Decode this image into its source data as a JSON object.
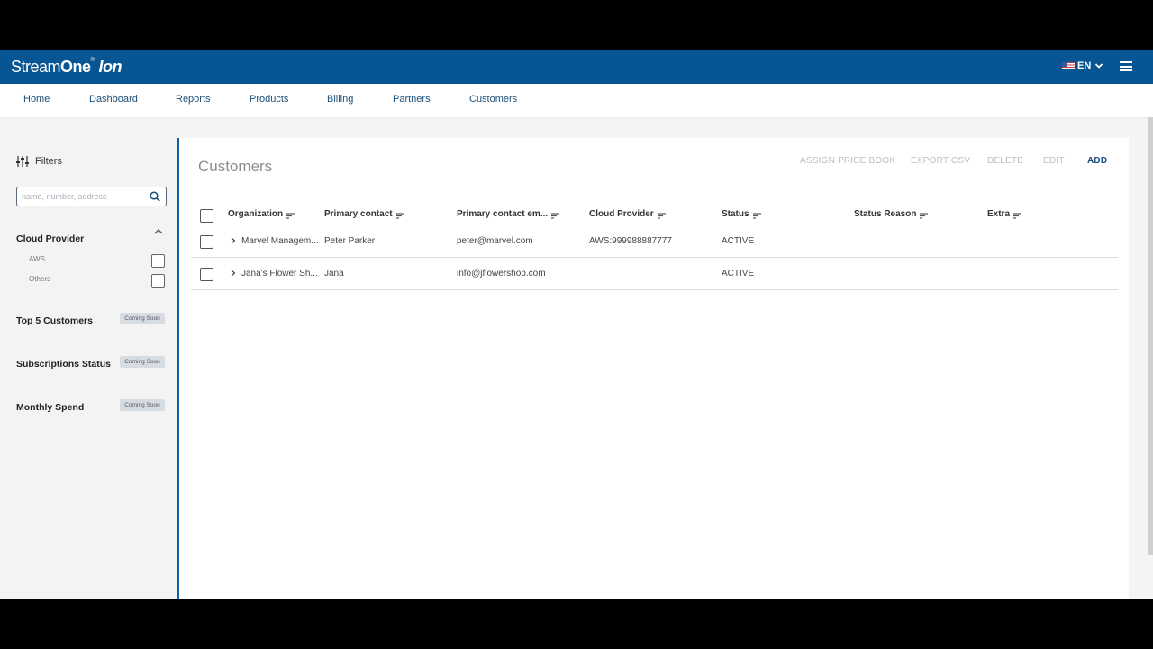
{
  "brand": {
    "part1": "Stream",
    "part2": "One",
    "reg": "®",
    "part3": "Ion"
  },
  "language": {
    "code": "EN"
  },
  "nav": {
    "items": [
      {
        "label": "Home"
      },
      {
        "label": "Dashboard"
      },
      {
        "label": "Reports"
      },
      {
        "label": "Products"
      },
      {
        "label": "Billing"
      },
      {
        "label": "Partners"
      },
      {
        "label": "Customers"
      }
    ]
  },
  "sidebar": {
    "filters_label": "Filters",
    "search_placeholder": "name, number, address",
    "cloud_provider": {
      "title": "Cloud Provider",
      "options": [
        {
          "label": "AWS",
          "checked": false
        },
        {
          "label": "Others",
          "checked": false
        }
      ]
    },
    "widgets": [
      {
        "title": "Top 5 Customers",
        "badge": "Coming Soon"
      },
      {
        "title": "Subscriptions Status",
        "badge": "Coming Soon"
      },
      {
        "title": "Monthly Spend",
        "badge": "Coming Soon"
      }
    ]
  },
  "main": {
    "title": "Customers",
    "actions": {
      "assign_price_book": "ASSIGN PRICE BOOK",
      "export_csv": "EXPORT CSV",
      "delete": "DELETE",
      "edit": "EDIT",
      "add": "ADD"
    },
    "columns": [
      {
        "label": "Organization"
      },
      {
        "label": "Primary contact"
      },
      {
        "label": "Primary contact em..."
      },
      {
        "label": "Cloud Provider"
      },
      {
        "label": "Status"
      },
      {
        "label": "Status Reason"
      },
      {
        "label": "Extra"
      }
    ],
    "rows": [
      {
        "organization": "Marvel Managem...",
        "contact": "Peter Parker",
        "email": "peter@marvel.com",
        "cloud": "AWS:999988887777",
        "status": "ACTIVE",
        "reason": "",
        "extra": ""
      },
      {
        "organization": "Jana's Flower Sh...",
        "contact": "Jana",
        "email": "info@jflowershop.com",
        "cloud": "",
        "status": "ACTIVE",
        "reason": "",
        "extra": ""
      }
    ]
  }
}
